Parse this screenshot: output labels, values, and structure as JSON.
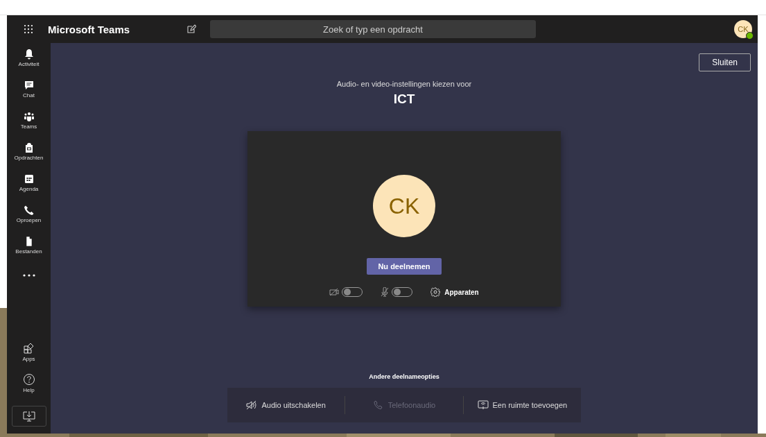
{
  "header": {
    "title": "Microsoft Teams",
    "search": {
      "placeholder": "Zoek of typ een opdracht"
    },
    "avatar": {
      "initials": "CK",
      "available": true
    }
  },
  "rail": {
    "items": [
      {
        "label": "Activiteit"
      },
      {
        "label": "Chat"
      },
      {
        "label": "Teams"
      },
      {
        "label": "Opdrachten"
      },
      {
        "label": "Agenda"
      },
      {
        "label": "Oproepen"
      },
      {
        "label": "Bestanden"
      }
    ],
    "bottom_items": [
      {
        "label": "Apps"
      },
      {
        "label": "Help"
      }
    ]
  },
  "close_button": "Sluiten",
  "prejoin": {
    "heading": "Audio- en video-instellingen kiezen voor",
    "meeting": "ICT",
    "avatar_initials": "CK",
    "join_button": "Nu deelnemen",
    "camera": {
      "on": false
    },
    "microphone": {
      "on": false
    },
    "devices_button": "Apparaten"
  },
  "other_options": {
    "title": "Andere deelnameopties",
    "options": [
      {
        "label": "Audio uitschakelen",
        "disabled": false
      },
      {
        "label": "Telefoonaudio",
        "disabled": true
      },
      {
        "label": "Een ruimte toevoegen",
        "disabled": false
      }
    ]
  }
}
